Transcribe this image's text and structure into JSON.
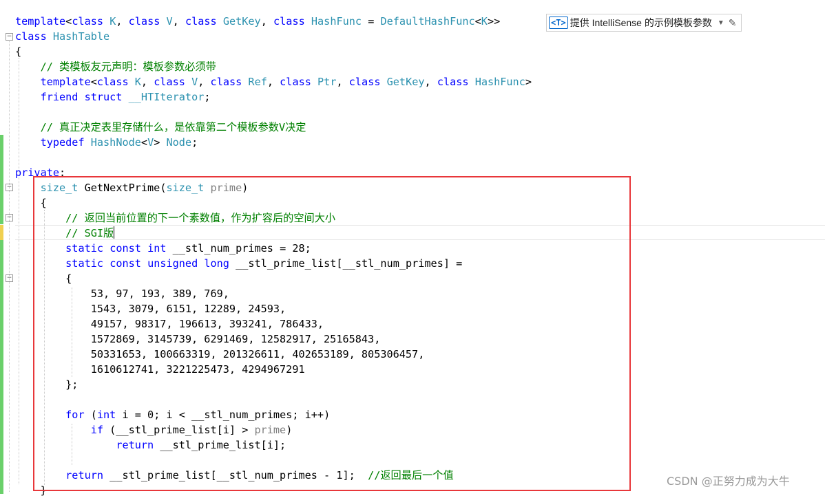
{
  "editor": {
    "intellisense_hint": {
      "badge": "<T>",
      "label": "提供 IntelliSense 的示例模板参数"
    },
    "lines": [
      [
        {
          "c": "kw",
          "t": "template"
        },
        {
          "t": "<"
        },
        {
          "c": "kw",
          "t": "class"
        },
        {
          "t": " "
        },
        {
          "c": "ty",
          "t": "K"
        },
        {
          "t": ", "
        },
        {
          "c": "kw",
          "t": "class"
        },
        {
          "t": " "
        },
        {
          "c": "ty",
          "t": "V"
        },
        {
          "t": ", "
        },
        {
          "c": "kw",
          "t": "class"
        },
        {
          "t": " "
        },
        {
          "c": "ty",
          "t": "GetKey"
        },
        {
          "t": ", "
        },
        {
          "c": "kw",
          "t": "class"
        },
        {
          "t": " "
        },
        {
          "c": "ty",
          "t": "HashFunc"
        },
        {
          "t": " = "
        },
        {
          "c": "ty",
          "t": "DefaultHashFunc"
        },
        {
          "t": "<"
        },
        {
          "c": "ty",
          "t": "K"
        },
        {
          "t": ">>"
        }
      ],
      [
        {
          "c": "kw",
          "t": "class"
        },
        {
          "t": " "
        },
        {
          "c": "ty",
          "t": "HashTable"
        }
      ],
      [
        {
          "t": "{"
        }
      ],
      [
        {
          "t": "    "
        },
        {
          "c": "cm",
          "t": "// 类模板友元声明：模板参数必须带"
        }
      ],
      [
        {
          "t": "    "
        },
        {
          "c": "kw",
          "t": "template"
        },
        {
          "t": "<"
        },
        {
          "c": "kw",
          "t": "class"
        },
        {
          "t": " "
        },
        {
          "c": "ty",
          "t": "K"
        },
        {
          "t": ", "
        },
        {
          "c": "kw",
          "t": "class"
        },
        {
          "t": " "
        },
        {
          "c": "ty",
          "t": "V"
        },
        {
          "t": ", "
        },
        {
          "c": "kw",
          "t": "class"
        },
        {
          "t": " "
        },
        {
          "c": "ty",
          "t": "Ref"
        },
        {
          "t": ", "
        },
        {
          "c": "kw",
          "t": "class"
        },
        {
          "t": " "
        },
        {
          "c": "ty",
          "t": "Ptr"
        },
        {
          "t": ", "
        },
        {
          "c": "kw",
          "t": "class"
        },
        {
          "t": " "
        },
        {
          "c": "ty",
          "t": "GetKey"
        },
        {
          "t": ", "
        },
        {
          "c": "kw",
          "t": "class"
        },
        {
          "t": " "
        },
        {
          "c": "ty",
          "t": "HashFunc"
        },
        {
          "t": ">"
        }
      ],
      [
        {
          "t": "    "
        },
        {
          "c": "kw",
          "t": "friend"
        },
        {
          "t": " "
        },
        {
          "c": "kw",
          "t": "struct"
        },
        {
          "t": " "
        },
        {
          "c": "ty",
          "t": "__HTIterator"
        },
        {
          "t": ";"
        }
      ],
      [
        {
          "t": ""
        }
      ],
      [
        {
          "t": "    "
        },
        {
          "c": "cm",
          "t": "// 真正决定表里存储什么，是依靠第二个模板参数V决定"
        }
      ],
      [
        {
          "t": "    "
        },
        {
          "c": "kw",
          "t": "typedef"
        },
        {
          "t": " "
        },
        {
          "c": "ty",
          "t": "HashNode"
        },
        {
          "t": "<"
        },
        {
          "c": "ty",
          "t": "V"
        },
        {
          "t": "> "
        },
        {
          "c": "ty",
          "t": "Node"
        },
        {
          "t": ";"
        }
      ],
      [
        {
          "t": ""
        }
      ],
      [
        {
          "c": "kw",
          "t": "private"
        },
        {
          "t": ":"
        }
      ],
      [
        {
          "t": "    "
        },
        {
          "c": "ty",
          "t": "size_t"
        },
        {
          "t": " GetNextPrime("
        },
        {
          "c": "ty",
          "t": "size_t"
        },
        {
          "t": " "
        },
        {
          "c": "pm",
          "t": "prime"
        },
        {
          "t": ")"
        }
      ],
      [
        {
          "t": "    {"
        }
      ],
      [
        {
          "t": "        "
        },
        {
          "c": "cm",
          "t": "// 返回当前位置的下一个素数值，作为扩容后的空间大小"
        }
      ],
      [
        {
          "t": "        "
        },
        {
          "c": "cm",
          "t": "// SGI版"
        },
        {
          "caret": true
        }
      ],
      [
        {
          "t": "        "
        },
        {
          "c": "kw",
          "t": "static"
        },
        {
          "t": " "
        },
        {
          "c": "kw",
          "t": "const"
        },
        {
          "t": " "
        },
        {
          "c": "kw",
          "t": "int"
        },
        {
          "t": " __stl_num_primes = 28;"
        }
      ],
      [
        {
          "t": "        "
        },
        {
          "c": "kw",
          "t": "static"
        },
        {
          "t": " "
        },
        {
          "c": "kw",
          "t": "const"
        },
        {
          "t": " "
        },
        {
          "c": "kw",
          "t": "unsigned"
        },
        {
          "t": " "
        },
        {
          "c": "kw",
          "t": "long"
        },
        {
          "t": " __stl_prime_list[__stl_num_primes] ="
        }
      ],
      [
        {
          "t": "        {"
        }
      ],
      [
        {
          "t": "            53, 97, 193, 389, 769,"
        }
      ],
      [
        {
          "t": "            1543, 3079, 6151, 12289, 24593,"
        }
      ],
      [
        {
          "t": "            49157, 98317, 196613, 393241, 786433,"
        }
      ],
      [
        {
          "t": "            1572869, 3145739, 6291469, 12582917, 25165843,"
        }
      ],
      [
        {
          "t": "            50331653, 100663319, 201326611, 402653189, 805306457,"
        }
      ],
      [
        {
          "t": "            1610612741, 3221225473, 4294967291"
        }
      ],
      [
        {
          "t": "        };"
        }
      ],
      [
        {
          "t": ""
        }
      ],
      [
        {
          "t": "        "
        },
        {
          "c": "kw",
          "t": "for"
        },
        {
          "t": " ("
        },
        {
          "c": "kw",
          "t": "int"
        },
        {
          "t": " i = 0; i < __stl_num_primes; i++)"
        }
      ],
      [
        {
          "t": "            "
        },
        {
          "c": "kw",
          "t": "if"
        },
        {
          "t": " (__stl_prime_list[i] > "
        },
        {
          "c": "pm",
          "t": "prime"
        },
        {
          "t": ")"
        }
      ],
      [
        {
          "t": "                "
        },
        {
          "c": "kw",
          "t": "return"
        },
        {
          "t": " __stl_prime_list[i];"
        }
      ],
      [
        {
          "t": ""
        }
      ],
      [
        {
          "t": "        "
        },
        {
          "c": "kw",
          "t": "return"
        },
        {
          "t": " __stl_prime_list[__stl_num_primes - 1];  "
        },
        {
          "c": "cm",
          "t": "//返回最后一个值"
        }
      ],
      [
        {
          "t": "    }"
        }
      ]
    ]
  },
  "watermark": "CSDN @正努力成为大牛",
  "colors": {
    "keyword": "#0000ff",
    "type": "#2b91af",
    "comment": "#008000",
    "parameter": "#808080",
    "change_bar_saved": "#6ad06a",
    "change_bar_unsaved": "#f0d050",
    "highlight_box": "#e8373a"
  }
}
